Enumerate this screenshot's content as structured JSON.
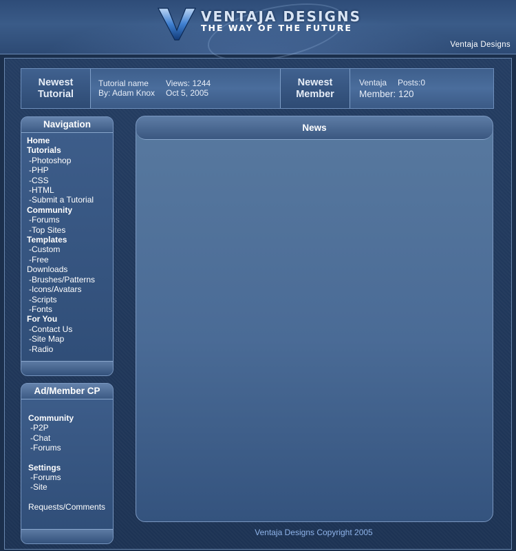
{
  "header": {
    "logo_title": "VENTAJA DESIGNS",
    "tagline": "THE WAY OF THE FUTURE",
    "brand_text": "Ventaja Designs"
  },
  "infobar": {
    "tutorial_label": "Newest\nTutorial",
    "tutorial_name": "Tutorial name",
    "tutorial_author": "By: Adam Knox",
    "tutorial_views": "Views: 1244",
    "tutorial_date": "Oct 5, 2005",
    "member_label": "Newest\nMember",
    "member_name": "Ventaja",
    "member_posts": "Posts:0",
    "member_count": "Member: 120"
  },
  "navigation": {
    "title": "Navigation",
    "items": [
      {
        "label": "Home",
        "kind": "cat"
      },
      {
        "label": "Tutorials",
        "kind": "cat"
      },
      {
        "label": "-Photoshop",
        "kind": "sub"
      },
      {
        "label": "-PHP",
        "kind": "sub"
      },
      {
        "label": "-CSS",
        "kind": "sub"
      },
      {
        "label": "-HTML",
        "kind": "sub"
      },
      {
        "label": "-Submit a Tutorial",
        "kind": "sub"
      },
      {
        "label": "Community",
        "kind": "cat"
      },
      {
        "label": "-Forums",
        "kind": "sub"
      },
      {
        "label": "-Top Sites",
        "kind": "sub"
      },
      {
        "label": "Templates",
        "kind": "cat"
      },
      {
        "label": "-Custom",
        "kind": "sub"
      },
      {
        "label": "-Free",
        "kind": "sub"
      },
      {
        "label": "Downloads",
        "kind": "plain"
      },
      {
        "label": "-Brushes/Patterns",
        "kind": "sub"
      },
      {
        "label": "-Icons/Avatars",
        "kind": "sub"
      },
      {
        "label": "-Scripts",
        "kind": "sub"
      },
      {
        "label": "-Fonts",
        "kind": "sub"
      },
      {
        "label": "For You",
        "kind": "cat"
      },
      {
        "label": "-Contact Us",
        "kind": "sub"
      },
      {
        "label": "-Site Map",
        "kind": "sub"
      },
      {
        "label": "-Radio",
        "kind": "sub"
      }
    ]
  },
  "member_cp": {
    "title": "Ad/Member CP",
    "items": [
      {
        "label": "Community",
        "kind": "cat"
      },
      {
        "label": "-P2P",
        "kind": "sub"
      },
      {
        "label": "-Chat",
        "kind": "sub"
      },
      {
        "label": "-Forums",
        "kind": "sub"
      },
      {
        "label": "Settings",
        "kind": "cat gap"
      },
      {
        "label": "-Forums",
        "kind": "sub"
      },
      {
        "label": "-Site",
        "kind": "sub"
      },
      {
        "label": "Requests/Comments",
        "kind": "plain gap"
      }
    ]
  },
  "news": {
    "title": "News"
  },
  "footer": {
    "copyright": "Ventaja Designs Copyright 2005"
  }
}
